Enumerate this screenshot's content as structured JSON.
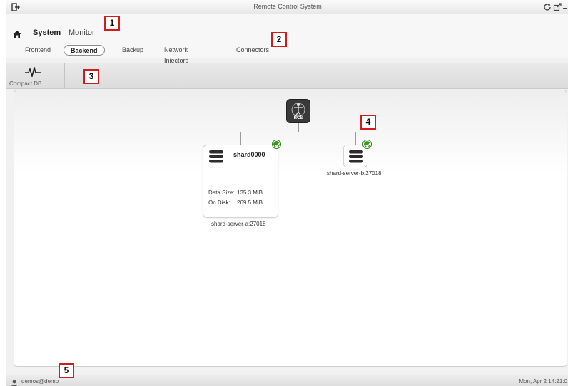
{
  "window": {
    "title": "Remote Control System"
  },
  "nav": {
    "system_label": "System",
    "monitor_label": "Monitor",
    "tabs": [
      {
        "label": "Frontend",
        "active": false
      },
      {
        "label": "Backend",
        "active": true
      },
      {
        "label": "Backup",
        "active": false
      },
      {
        "label": "Network Injectors",
        "active": false
      },
      {
        "label": "Connectors",
        "active": false
      }
    ]
  },
  "toolbar": {
    "compact_db_label": "Compact DB",
    "compact_db_icon": "pulse-icon"
  },
  "topology": {
    "root": {
      "label": "RCS",
      "icon": "rcs-logo-icon"
    },
    "shard": {
      "name": "shard0000",
      "data_size_label": "Data Size:",
      "data_size_value": "135.3 MiB",
      "on_disk_label": "On Disk:",
      "on_disk_value": "269.5 MiB",
      "server": "shard-server-a:27018",
      "status": "ok"
    },
    "server_b": {
      "server": "shard-server-b:27018",
      "status": "ok"
    }
  },
  "statusbar": {
    "user": "demos@demo",
    "clock": "Mon, Apr 2  14:21:0"
  },
  "callouts": [
    "1",
    "2",
    "3",
    "4",
    "5"
  ],
  "colors": {
    "callout_border": "#d01c1c",
    "status_ok": "#3a9a1f",
    "logo_bg": "#3a3a3a"
  }
}
